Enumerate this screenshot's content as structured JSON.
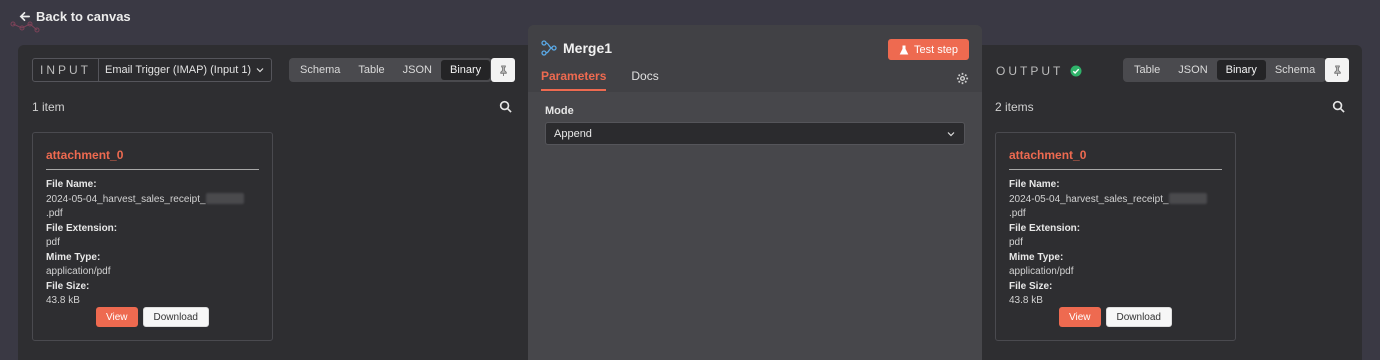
{
  "nav": {
    "back_label": "Back to canvas"
  },
  "input": {
    "label": "INPUT",
    "node_select": "Email Trigger (IMAP) (Input 1)",
    "views": [
      "Schema",
      "Table",
      "JSON",
      "Binary"
    ],
    "active_view": "Binary",
    "count": "1 item",
    "card": {
      "title": "attachment_0",
      "fields": [
        {
          "key": "File Name:",
          "value_prefix": "2024-05-04_harvest_sales_receipt_",
          "value_suffix": ".pdf"
        },
        {
          "key": "File Extension:",
          "value": "pdf"
        },
        {
          "key": "Mime Type:",
          "value": "application/pdf"
        },
        {
          "key": "File Size:",
          "value": "43.8 kB"
        }
      ],
      "view_label": "View",
      "download_label": "Download"
    }
  },
  "node": {
    "title": "Merge1",
    "test_label": "Test step",
    "tabs": [
      "Parameters",
      "Docs"
    ],
    "active_tab": "Parameters",
    "mode_label": "Mode",
    "mode_value": "Append"
  },
  "output": {
    "label": "OUTPUT",
    "views": [
      "Table",
      "JSON",
      "Binary",
      "Schema"
    ],
    "active_view": "Binary",
    "count": "2 items",
    "card": {
      "title": "attachment_0",
      "fields": [
        {
          "key": "File Name:",
          "value_prefix": "2024-05-04_harvest_sales_receipt_",
          "value_suffix": ".pdf"
        },
        {
          "key": "File Extension:",
          "value": "pdf"
        },
        {
          "key": "Mime Type:",
          "value": "application/pdf"
        },
        {
          "key": "File Size:",
          "value": "43.8 kB"
        }
      ],
      "view_label": "View",
      "download_label": "Download"
    }
  },
  "colors": {
    "accent": "#ee6a50",
    "success": "#2fb36a",
    "panel_bg": "#2e2e31"
  }
}
